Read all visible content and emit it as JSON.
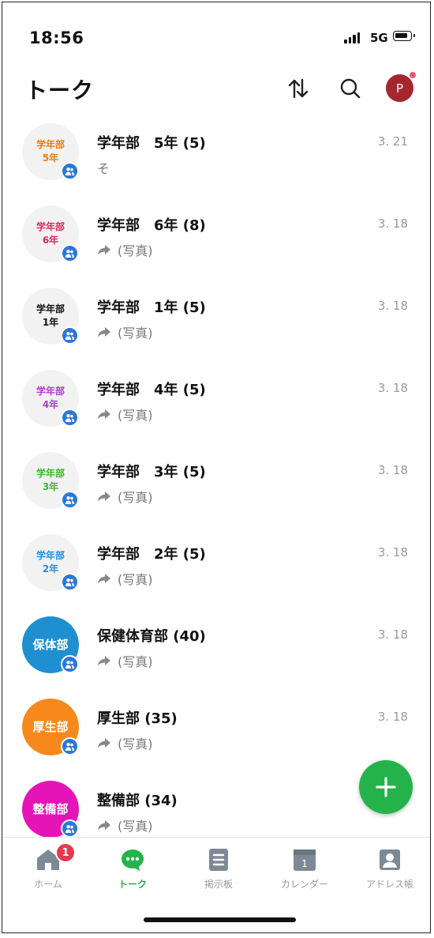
{
  "status": {
    "time": "18:56",
    "network": "5G"
  },
  "header": {
    "title": "トーク",
    "profile_initial": "P"
  },
  "chats": [
    {
      "avatar_line1": "学年部",
      "avatar_line2": "5年",
      "avatar_color": "#f07b12",
      "name": "学年部　5年 (5)",
      "preview": "そ",
      "photo": false,
      "date": "3. 21"
    },
    {
      "avatar_line1": "学年部",
      "avatar_line2": "6年",
      "avatar_color": "#e02a5e",
      "name": "学年部　6年 (8)",
      "preview": "(写真)",
      "photo": true,
      "date": "3. 18"
    },
    {
      "avatar_line1": "学年部",
      "avatar_line2": "1年",
      "avatar_color": "#111111",
      "name": "学年部　1年 (5)",
      "preview": "(写真)",
      "photo": true,
      "date": "3. 18"
    },
    {
      "avatar_line1": "学年部",
      "avatar_line2": "4年",
      "avatar_color": "#b43bd1",
      "name": "学年部　4年 (5)",
      "preview": "(写真)",
      "photo": true,
      "date": "3. 18"
    },
    {
      "avatar_line1": "学年部",
      "avatar_line2": "3年",
      "avatar_color": "#3ab92e",
      "name": "学年部　3年 (5)",
      "preview": "(写真)",
      "photo": true,
      "date": "3. 18"
    },
    {
      "avatar_line1": "学年部",
      "avatar_line2": "2年",
      "avatar_color": "#2a8fd6",
      "name": "学年部　2年 (5)",
      "preview": "(写真)",
      "photo": true,
      "date": "3. 18"
    },
    {
      "avatar_line1": "保体部",
      "avatar_line2": "",
      "avatar_color": "#1f8fd2",
      "name": "保健体育部 (40)",
      "preview": "(写真)",
      "photo": true,
      "date": "3. 18"
    },
    {
      "avatar_line1": "厚生部",
      "avatar_line2": "",
      "avatar_color": "#f7891c",
      "name": "厚生部 (35)",
      "preview": "(写真)",
      "photo": true,
      "date": "3. 18"
    },
    {
      "avatar_line1": "整備部",
      "avatar_line2": "",
      "avatar_color": "#e514b7",
      "name": "整備部 (34)",
      "preview": "(写真)",
      "photo": true,
      "date": ""
    }
  ],
  "tabs": [
    {
      "label": "ホーム",
      "icon": "home-icon",
      "badge": "1"
    },
    {
      "label": "トーク",
      "icon": "chat-icon",
      "active": true
    },
    {
      "label": "掲示板",
      "icon": "board-icon"
    },
    {
      "label": "カレンダー",
      "icon": "calendar-icon",
      "calendar_day": "1"
    },
    {
      "label": "アドレス帳",
      "icon": "address-book-icon"
    }
  ],
  "colors": {
    "accent": "#24b34b",
    "badge": "#e53950",
    "group_badge": "#2a77d9"
  }
}
